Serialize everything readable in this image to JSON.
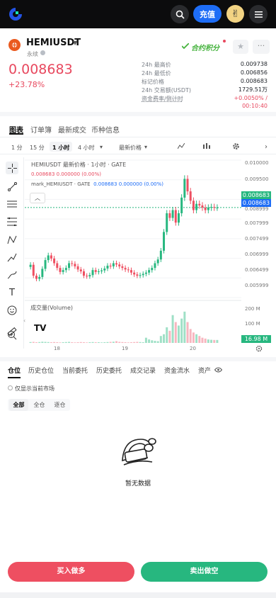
{
  "topbar": {
    "deposit_label": "充值",
    "avatar_emoji": "✌"
  },
  "header": {
    "pair": "HEMIUSDT",
    "type": "永续",
    "price": "0.008683",
    "change_pct": "+23.78%",
    "contract_label": "合约积分",
    "stats": [
      {
        "label": "24h 最高价",
        "value": "0.009738"
      },
      {
        "label": "24h 最低价",
        "value": "0.006856"
      },
      {
        "label": "标记价格",
        "value": "0.008683"
      },
      {
        "label": "24h 交易额(USDT)",
        "value": "1729.51万"
      },
      {
        "label": "资金费率/倒计时",
        "value": "+0.0050% /"
      },
      {
        "label": "",
        "value": "00:10:40"
      }
    ]
  },
  "tabs": [
    "图表",
    "订单簿",
    "最新成交",
    "币种信息"
  ],
  "toolbar": {
    "intervals": [
      "1 分",
      "15 分",
      "1 小时",
      "4 小时"
    ],
    "price_type": "最新价格"
  },
  "chart_info": {
    "line1": "HEMIUSDT 最新价格 · 1小时 · GATE",
    "line2": "0.008683  0.000000 (0.00%)",
    "line3_label": "mark_HEMIUSDT · GATE",
    "line3_value": "0.008683  0.000000 (0.00%)",
    "volume_label": "成交量(Volume)"
  },
  "chart_data": {
    "type": "candlestick",
    "title": "HEMIUSDT 最新价格 · 1小时 · GATE",
    "y_ticks": [
      "0.010000",
      "0.009500",
      "0.008999",
      "0.007999",
      "0.007499",
      "0.006999",
      "0.006499",
      "0.005999"
    ],
    "last_price": "0.008683",
    "mark_price": "0.008683",
    "volume_ticks": [
      "200 M",
      "100 M"
    ],
    "volume_last": "16.98 M",
    "x_ticks": [
      "18",
      "19",
      "20"
    ],
    "close_series": [
      0.00685,
      0.0065,
      0.0064,
      0.00646,
      0.00672,
      0.007,
      0.00715,
      0.00705,
      0.0069,
      0.00675,
      0.00662,
      0.00668,
      0.00675,
      0.0069,
      0.00688,
      0.0068,
      0.0067,
      0.00664,
      0.0065,
      0.00648,
      0.00652,
      0.00668,
      0.00662,
      0.00664,
      0.00667,
      0.00673,
      0.00682,
      0.0068,
      0.0069,
      0.00686,
      0.0068,
      0.00675,
      0.0067,
      0.00668,
      0.0066,
      0.00654,
      0.0065,
      0.00652,
      0.00656,
      0.0066,
      0.00668,
      0.00675,
      0.0069,
      0.00702,
      0.0073,
      0.0079,
      0.0085,
      0.00835,
      0.0086,
      0.0082,
      0.0085,
      0.009,
      0.0096,
      0.0092,
      0.0089,
      0.0086,
      0.0088,
      0.00875,
      0.00868,
      0.0086,
      0.00868,
      0.0087,
      0.00868,
      0.00868
    ],
    "volume_series": [
      5,
      6,
      4,
      5,
      7,
      6,
      5,
      4,
      5,
      4,
      3,
      4,
      5,
      6,
      4,
      3,
      4,
      5,
      4,
      3,
      4,
      5,
      4,
      4,
      3,
      4,
      5,
      6,
      7,
      10,
      6,
      5,
      4,
      3,
      4,
      5,
      6,
      5,
      4,
      30,
      20,
      15,
      12,
      10,
      40,
      50,
      90,
      70,
      160,
      120,
      100,
      140,
      180,
      120,
      80,
      60,
      50,
      40,
      30,
      25,
      20,
      18,
      17,
      17
    ]
  },
  "orders": {
    "tabs": [
      "仓位",
      "历史仓位",
      "当前委托",
      "历史委托",
      "成交记录",
      "资金流水",
      "资产"
    ],
    "only_current": "仅显示当前市场",
    "segments": [
      "全部",
      "全仓",
      "逐仓"
    ],
    "empty": "暂无数据"
  },
  "actions": {
    "buy": "买入做多",
    "sell": "卖出做空"
  },
  "colors": {
    "up": "#27b77f",
    "down": "#ee4f61",
    "accent": "#1e6df6"
  }
}
